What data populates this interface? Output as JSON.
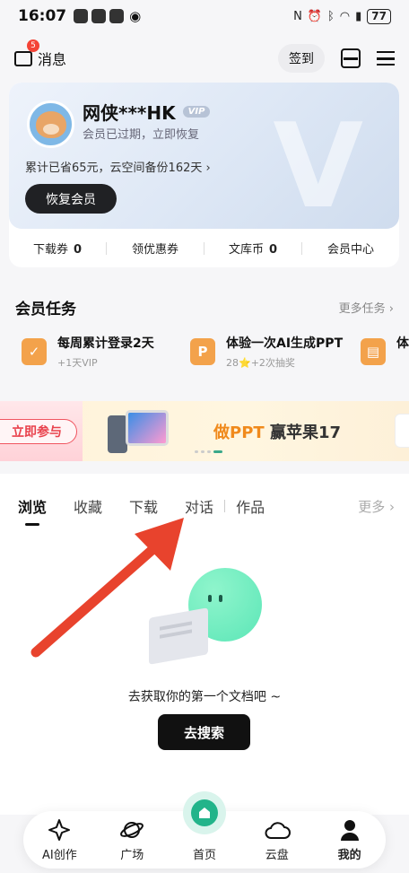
{
  "status_bar": {
    "time": "16:07",
    "battery": "77"
  },
  "header": {
    "messages_label": "消息",
    "messages_badge": "5",
    "signin_label": "签到"
  },
  "member_card": {
    "username": "网侠***HK",
    "vip_label": "VIP",
    "status_text": "会员已过期，立即恢复",
    "savings_text": "累计已省65元，云空间备份162天 ›",
    "renew_button": "恢复会员",
    "stats": [
      {
        "label": "下载券",
        "value": "0"
      },
      {
        "label": "领优惠券",
        "value": ""
      },
      {
        "label": "文库币",
        "value": "0"
      },
      {
        "label": "会员中心",
        "value": ""
      }
    ]
  },
  "tasks": {
    "title": "会员任务",
    "more_label": "更多任务 ›",
    "items": [
      {
        "title": "每周累计登录2天",
        "sub": "+1天VIP",
        "icon": "calendar-check-icon"
      },
      {
        "title": "体验一次AI生成PPT",
        "sub": "28⭐+2次抽奖",
        "icon": "ppt-icon"
      },
      {
        "title": "体",
        "sub": "",
        "icon": "doc-camera-icon"
      }
    ]
  },
  "banner": {
    "join_label": "立即参与",
    "headline_highlight": "做PPT",
    "headline_rest": " 赢苹果17"
  },
  "content_tabs": {
    "tabs": [
      "浏览",
      "收藏",
      "下载",
      "对话",
      "作品"
    ],
    "active_index": 0,
    "more_label": "更多 ›"
  },
  "empty_state": {
    "message": "去获取你的第一个文档吧 ~",
    "button": "去搜索"
  },
  "bottom_nav": {
    "items": [
      {
        "label": "AI创作",
        "icon": "sparkle-icon"
      },
      {
        "label": "广场",
        "icon": "planet-icon"
      },
      {
        "label": "首页",
        "icon": "home-icon"
      },
      {
        "label": "云盘",
        "icon": "cloud-icon"
      },
      {
        "label": "我的",
        "icon": "person-icon"
      }
    ],
    "active_index": 4
  },
  "colors": {
    "accent_green": "#22b48a",
    "annotation_arrow": "#e8432d",
    "task_icon": "#f3a24b"
  }
}
